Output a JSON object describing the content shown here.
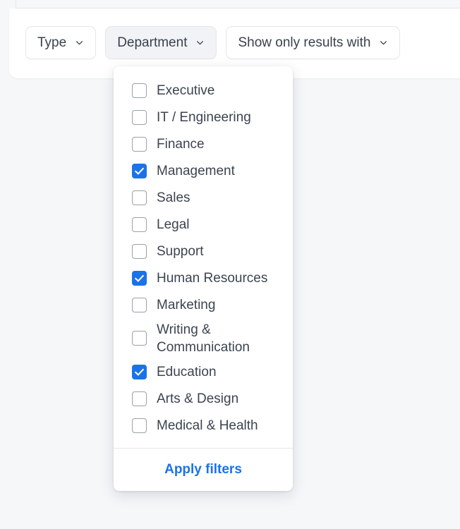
{
  "toolbar": {
    "filters": [
      {
        "label": "Type",
        "active": false,
        "icon": "chevron-down-icon",
        "name": "filter-button-type"
      },
      {
        "label": "Department",
        "active": true,
        "icon": "chevron-down-icon",
        "name": "filter-button-department"
      },
      {
        "label": "Show only results with",
        "active": false,
        "icon": "chevron-down-icon",
        "name": "filter-button-show-only-results-with"
      }
    ]
  },
  "dropdown": {
    "owner": "Department",
    "items": [
      {
        "label": "Executive",
        "checked": false
      },
      {
        "label": "IT / Engineering",
        "checked": false
      },
      {
        "label": "Finance",
        "checked": false
      },
      {
        "label": "Management",
        "checked": true
      },
      {
        "label": "Sales",
        "checked": false
      },
      {
        "label": "Legal",
        "checked": false
      },
      {
        "label": "Support",
        "checked": false
      },
      {
        "label": "Human Resources",
        "checked": true
      },
      {
        "label": "Marketing",
        "checked": false
      },
      {
        "label": "Writing & Communication",
        "checked": false
      },
      {
        "label": "Education",
        "checked": true
      },
      {
        "label": "Arts & Design",
        "checked": false
      },
      {
        "label": "Medical & Health",
        "checked": false
      }
    ],
    "apply_label": "Apply filters"
  },
  "colors": {
    "accent": "#1a73e8",
    "page_background": "#f6f7f9",
    "surface": "#ffffff",
    "text": "#3c4450",
    "border": "#e4e7eb",
    "active_button_background": "#f1f3f6"
  }
}
